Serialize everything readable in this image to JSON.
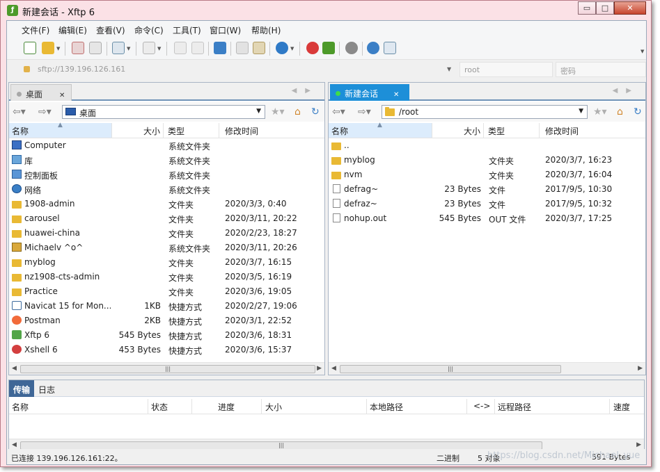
{
  "window": {
    "title": "新建会话 - Xftp 6",
    "app_icon": "xftp-icon",
    "controls": {
      "minimize": "▭",
      "maximize": "□",
      "close": "✕"
    }
  },
  "menu": [
    "文件(F)",
    "编辑(E)",
    "查看(V)",
    "命令(C)",
    "工具(T)",
    "窗口(W)",
    "帮助(H)"
  ],
  "toolbar": {
    "icons": [
      "new-session-icon",
      "open-folder-icon",
      "disconnect-icon",
      "reconnect-icon",
      "transfer-settings-icon",
      "play-icon",
      "copy-icon",
      "paste-icon",
      "sync-icon",
      "copy-file-icon",
      "properties-icon",
      "globe-icon",
      "xshell-icon",
      "xftp-icon",
      "settings-icon",
      "help-icon",
      "chat-icon"
    ]
  },
  "address": {
    "host_placeholder": "sftp://139.196.126.161",
    "user_placeholder": "root",
    "password_placeholder": "密码"
  },
  "left_pane": {
    "tab_label": "桌面",
    "path": "桌面",
    "columns": {
      "name": "名称",
      "size": "大小",
      "type": "类型",
      "modified": "修改时间"
    },
    "rows": [
      {
        "icon": "computer-icon",
        "name": "Computer",
        "size": "",
        "type": "系统文件夹",
        "modified": ""
      },
      {
        "icon": "library-icon",
        "name": "库",
        "size": "",
        "type": "系统文件夹",
        "modified": ""
      },
      {
        "icon": "control-panel-icon",
        "name": "控制面板",
        "size": "",
        "type": "系统文件夹",
        "modified": ""
      },
      {
        "icon": "network-icon",
        "name": "网络",
        "size": "",
        "type": "系统文件夹",
        "modified": ""
      },
      {
        "icon": "folder-icon",
        "name": "1908-admin",
        "size": "",
        "type": "文件夹",
        "modified": "2020/3/3, 0:40"
      },
      {
        "icon": "folder-icon",
        "name": "carousel",
        "size": "",
        "type": "文件夹",
        "modified": "2020/3/11, 20:22"
      },
      {
        "icon": "folder-icon",
        "name": "huawei-china",
        "size": "",
        "type": "文件夹",
        "modified": "2020/2/23, 18:27"
      },
      {
        "icon": "user-folder-icon",
        "name": "Michaelv ^o^",
        "size": "",
        "type": "系统文件夹",
        "modified": "2020/3/11, 20:26"
      },
      {
        "icon": "folder-icon",
        "name": "myblog",
        "size": "",
        "type": "文件夹",
        "modified": "2020/3/7, 16:15"
      },
      {
        "icon": "folder-icon",
        "name": "nz1908-cts-admin",
        "size": "",
        "type": "文件夹",
        "modified": "2020/3/5, 16:19"
      },
      {
        "icon": "folder-icon",
        "name": "Practice",
        "size": "",
        "type": "文件夹",
        "modified": "2020/3/6, 19:05"
      },
      {
        "icon": "navicat-shortcut-icon",
        "name": "Navicat 15 for Mon...",
        "size": "1KB",
        "type": "快捷方式",
        "modified": "2020/2/27, 19:06"
      },
      {
        "icon": "postman-shortcut-icon",
        "name": "Postman",
        "size": "2KB",
        "type": "快捷方式",
        "modified": "2020/3/1, 22:52"
      },
      {
        "icon": "xftp-shortcut-icon",
        "name": "Xftp 6",
        "size": "545 Bytes",
        "type": "快捷方式",
        "modified": "2020/3/6, 18:31"
      },
      {
        "icon": "xshell-shortcut-icon",
        "name": "Xshell 6",
        "size": "453 Bytes",
        "type": "快捷方式",
        "modified": "2020/3/6, 15:37"
      }
    ]
  },
  "right_pane": {
    "tab_label": "新建会话",
    "path": "/root",
    "columns": {
      "name": "名称",
      "size": "大小",
      "type": "类型",
      "modified": "修改时间"
    },
    "rows": [
      {
        "icon": "folder-icon",
        "name": "..",
        "size": "",
        "type": "",
        "modified": ""
      },
      {
        "icon": "folder-icon",
        "name": "myblog",
        "size": "",
        "type": "文件夹",
        "modified": "2020/3/7, 16:23"
      },
      {
        "icon": "folder-icon",
        "name": "nvm",
        "size": "",
        "type": "文件夹",
        "modified": "2020/3/7, 16:04"
      },
      {
        "icon": "file-icon",
        "name": "defrag~",
        "size": "23 Bytes",
        "type": "文件",
        "modified": "2017/9/5, 10:30"
      },
      {
        "icon": "file-icon",
        "name": "defraz~",
        "size": "23 Bytes",
        "type": "文件",
        "modified": "2017/9/5, 10:32"
      },
      {
        "icon": "file-icon",
        "name": "nohup.out",
        "size": "545 Bytes",
        "type": "OUT 文件",
        "modified": "2020/3/7, 17:25"
      }
    ]
  },
  "transfer": {
    "tabs": [
      "传输",
      "日志"
    ],
    "columns": [
      "名称",
      "状态",
      "进度",
      "大小",
      "本地路径",
      "<->",
      "远程路径",
      "速度"
    ]
  },
  "status": {
    "connection": "已连接 139.196.126.161:22。",
    "mode": "二进制",
    "objects": "5 对象",
    "size": "591 Bytes"
  },
  "watermark": "https://blog.csdn.net/Michael_yue"
}
